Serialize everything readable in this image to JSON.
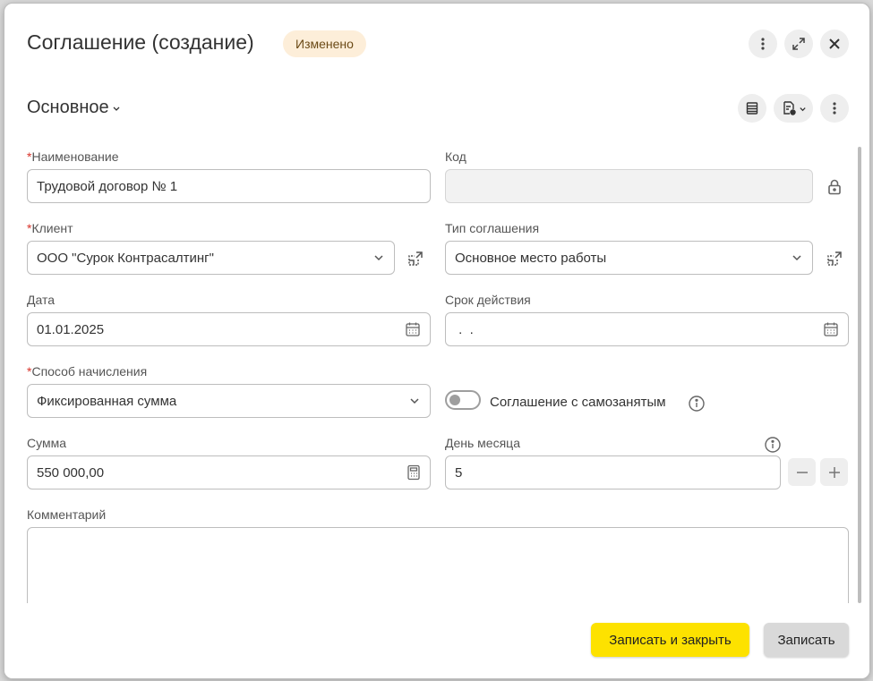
{
  "header": {
    "title": "Соглашение (создание)",
    "status_badge": "Изменено"
  },
  "section": {
    "title": "Основное"
  },
  "form": {
    "name": {
      "label": "Наименование",
      "required_mark": "*",
      "value": "Трудовой договор № 1"
    },
    "code": {
      "label": "Код",
      "value": ""
    },
    "client": {
      "label": "Клиент",
      "required_mark": "*",
      "value": "ООО \"Сурок Контрасалтинг\""
    },
    "agreement_type": {
      "label": "Тип соглашения",
      "value": "Основное место работы"
    },
    "date": {
      "label": "Дата",
      "value": "01.01.2025"
    },
    "validity": {
      "label": "Срок действия",
      "value": " .  ."
    },
    "accrual_method": {
      "label": "Способ начисления",
      "required_mark": "*",
      "value": "Фиксированная сумма"
    },
    "self_employed": {
      "label": "Соглашение с самозанятым",
      "checked": false
    },
    "amount": {
      "label": "Сумма",
      "value": "550 000,00"
    },
    "day_of_month": {
      "label": "День месяца",
      "value": "5"
    },
    "comment": {
      "label": "Комментарий",
      "value": ""
    }
  },
  "footer": {
    "save_close_label": "Записать и закрыть",
    "save_label": "Записать"
  },
  "colors": {
    "primary_button": "#fde200",
    "badge_bg": "#fdeed9",
    "required": "#d9342b"
  },
  "icons": [
    "more-vertical-icon",
    "expand-icon",
    "close-icon",
    "list-icon",
    "report-icon",
    "lock-icon",
    "open-link-icon",
    "calendar-icon",
    "calculator-icon",
    "info-icon",
    "minus-icon",
    "plus-icon",
    "chevron-down-icon"
  ]
}
